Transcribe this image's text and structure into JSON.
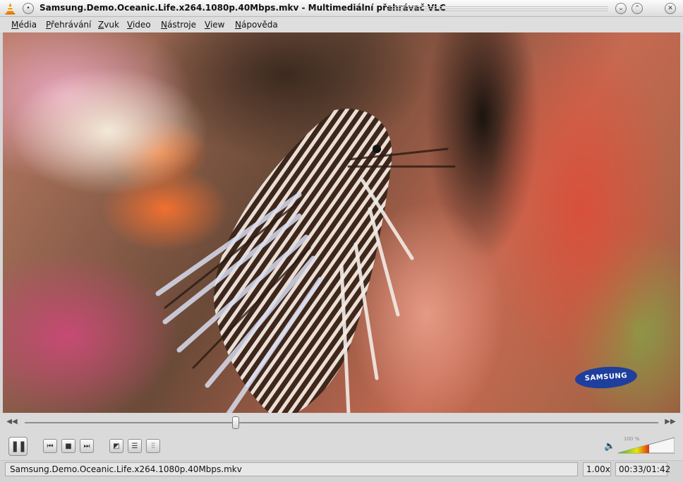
{
  "window": {
    "title": "Samsung.Demo.Oceanic.Life.x264.1080p.40Mbps.mkv - Multimediální přehrávač VLC",
    "app_icon": "vlc-cone-icon",
    "accent_color": "#f08a00"
  },
  "menu": {
    "items": [
      "Média",
      "Přehrávání",
      "Zvuk",
      "Video",
      "Nástroje",
      "View",
      "Nápověda"
    ]
  },
  "video": {
    "watermark": "SAMSUNG",
    "watermark_color": "#1f3f9e"
  },
  "seek": {
    "position_fraction": 0.333
  },
  "controls": {
    "icons": [
      "pause-icon",
      "previous-icon",
      "stop-icon",
      "next-icon",
      "fullscreen-icon",
      "playlist-icon",
      "extended-settings-icon"
    ]
  },
  "volume": {
    "label": "100 %",
    "level_fraction": 0.55,
    "icon": "speaker-icon"
  },
  "status": {
    "filename": "Samsung.Demo.Oceanic.Life.x264.1080p.40Mbps.mkv",
    "speed": "1.00x",
    "time": "00:33/01:42"
  }
}
